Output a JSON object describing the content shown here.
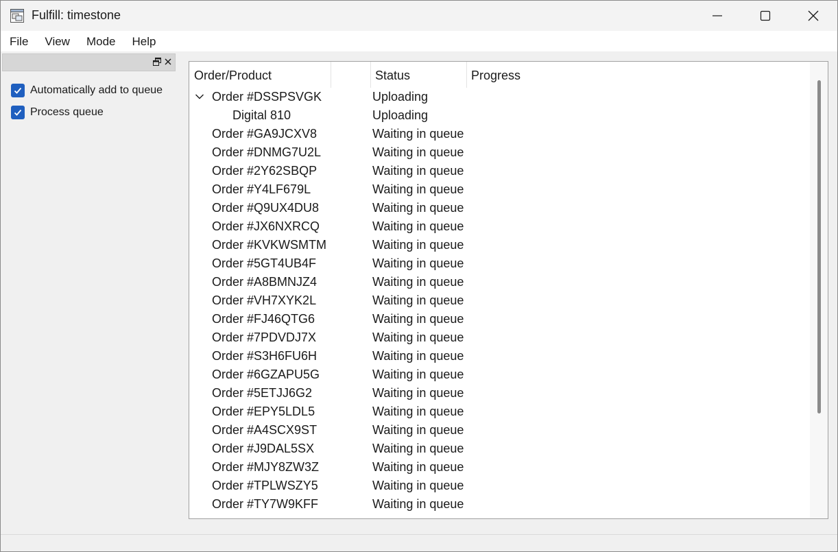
{
  "window": {
    "title": "Fulfill: timestone",
    "app_icon": "app-window-icon",
    "controls": {
      "minimize_icon": "minimize-icon",
      "maximize_icon": "maximize-icon",
      "close_icon": "close-icon"
    }
  },
  "menubar": {
    "items": [
      {
        "label": "File"
      },
      {
        "label": "View"
      },
      {
        "label": "Mode"
      },
      {
        "label": "Help"
      }
    ]
  },
  "dock": {
    "float_icon": "restore-float-icon",
    "close_icon": "close-icon",
    "options": [
      {
        "label": "Automatically add to queue",
        "checked": true
      },
      {
        "label": "Process queue",
        "checked": true
      }
    ]
  },
  "tree": {
    "columns": [
      {
        "label": "Order/Product"
      },
      {
        "label": "Status"
      },
      {
        "label": "Progress"
      }
    ],
    "rows": [
      {
        "name": "Order #DSSPSVGK",
        "status": "Uploading",
        "expanded": true,
        "level": 0
      },
      {
        "name": "Digital 810",
        "status": "Uploading",
        "level": 1
      },
      {
        "name": "Order #GA9JCXV8",
        "status": "Waiting in queue",
        "level": 0
      },
      {
        "name": "Order #DNMG7U2L",
        "status": "Waiting in queue",
        "level": 0
      },
      {
        "name": "Order #2Y62SBQP",
        "status": "Waiting in queue",
        "level": 0
      },
      {
        "name": "Order #Y4LF679L",
        "status": "Waiting in queue",
        "level": 0
      },
      {
        "name": "Order #Q9UX4DU8",
        "status": "Waiting in queue",
        "level": 0
      },
      {
        "name": "Order #JX6NXRCQ",
        "status": "Waiting in queue",
        "level": 0
      },
      {
        "name": "Order #KVKWSMTM",
        "status": "Waiting in queue",
        "level": 0
      },
      {
        "name": "Order #5GT4UB4F",
        "status": "Waiting in queue",
        "level": 0
      },
      {
        "name": "Order #A8BMNJZ4",
        "status": "Waiting in queue",
        "level": 0
      },
      {
        "name": "Order #VH7XYK2L",
        "status": "Waiting in queue",
        "level": 0
      },
      {
        "name": "Order #FJ46QTG6",
        "status": "Waiting in queue",
        "level": 0
      },
      {
        "name": "Order #7PDVDJ7X",
        "status": "Waiting in queue",
        "level": 0
      },
      {
        "name": "Order #S3H6FU6H",
        "status": "Waiting in queue",
        "level": 0
      },
      {
        "name": "Order #6GZAPU5G",
        "status": "Waiting in queue",
        "level": 0
      },
      {
        "name": "Order #5ETJJ6G2",
        "status": "Waiting in queue",
        "level": 0
      },
      {
        "name": "Order #EPY5LDL5",
        "status": "Waiting in queue",
        "level": 0
      },
      {
        "name": "Order #A4SCX9ST",
        "status": "Waiting in queue",
        "level": 0
      },
      {
        "name": "Order #J9DAL5SX",
        "status": "Waiting in queue",
        "level": 0
      },
      {
        "name": "Order #MJY8ZW3Z",
        "status": "Waiting in queue",
        "level": 0
      },
      {
        "name": "Order #TPLWSZY5",
        "status": "Waiting in queue",
        "level": 0
      },
      {
        "name": "Order #TY7W9KFF",
        "status": "Waiting in queue",
        "level": 0
      }
    ]
  },
  "colors": {
    "accent": "#1f5fbf",
    "title_bar": "#f3f3f3",
    "panel_bg": "#f0f0f0"
  }
}
